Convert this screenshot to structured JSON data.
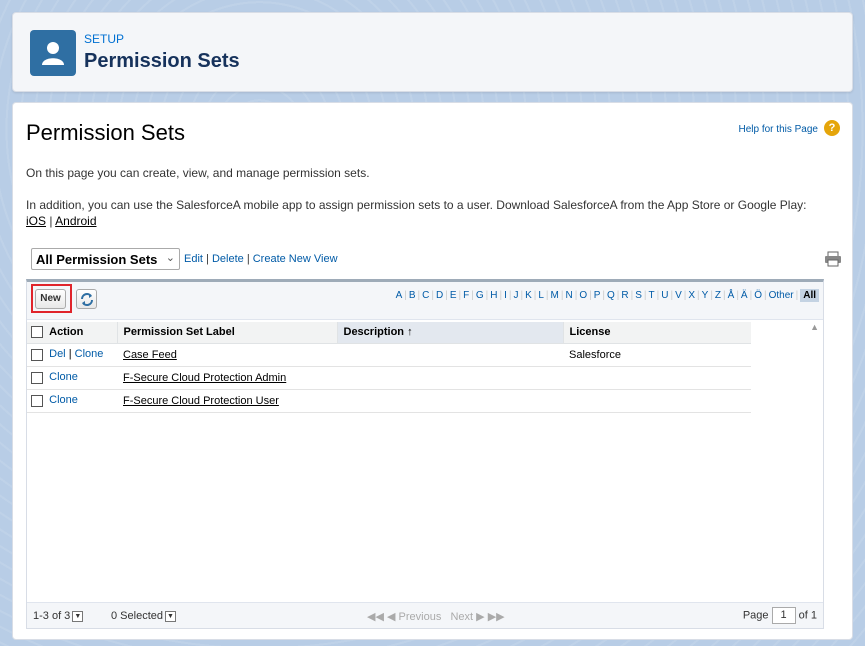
{
  "header": {
    "eyebrow": "SETUP",
    "title": "Permission Sets",
    "icon": "user-icon"
  },
  "main": {
    "title": "Permission Sets",
    "help_label": "Help for this Page",
    "intro": "On this page you can create, view, and manage permission sets.",
    "intro2_text": "In addition, you can use the SalesforceA mobile app to assign permission sets to a user. Download SalesforceA from the App Store or Google Play: ",
    "ios_link": "iOS",
    "link_sep": " | ",
    "android_link": "Android"
  },
  "view": {
    "selected": "All Permission Sets",
    "edit": "Edit",
    "delete": "Delete",
    "create": "Create New View",
    "sep": "|"
  },
  "toolbar": {
    "new_label": "New"
  },
  "alphabet": [
    "A",
    "B",
    "C",
    "D",
    "E",
    "F",
    "G",
    "H",
    "I",
    "J",
    "K",
    "L",
    "M",
    "N",
    "O",
    "P",
    "Q",
    "R",
    "S",
    "T",
    "U",
    "V",
    "X",
    "Y",
    "Z",
    "Å",
    "Ä",
    "Ö",
    "Other",
    "All"
  ],
  "table": {
    "columns": [
      "Action",
      "Permission Set Label",
      "Description",
      "License"
    ],
    "sort_indicator": "↑",
    "rows": [
      {
        "del": "Del",
        "sep": "|",
        "clone": "Clone",
        "label": "Case Feed",
        "description": "",
        "license": "Salesforce"
      },
      {
        "clone": "Clone",
        "label": "F-Secure Cloud Protection Admin",
        "description": "",
        "license": ""
      },
      {
        "clone": "Clone",
        "label": "F-Secure Cloud Protection User",
        "description": "",
        "license": ""
      }
    ]
  },
  "footer": {
    "count": "1-3 of 3",
    "selected": "0 Selected",
    "previous": "Previous",
    "next": "Next",
    "page_label": "Page",
    "page_value": "1",
    "of_label": "of 1"
  },
  "colors": {
    "brand_icon": "#2f6fa3",
    "link": "#015ba7",
    "highlight": "#e0242b",
    "help_icon": "#e5a50a"
  }
}
